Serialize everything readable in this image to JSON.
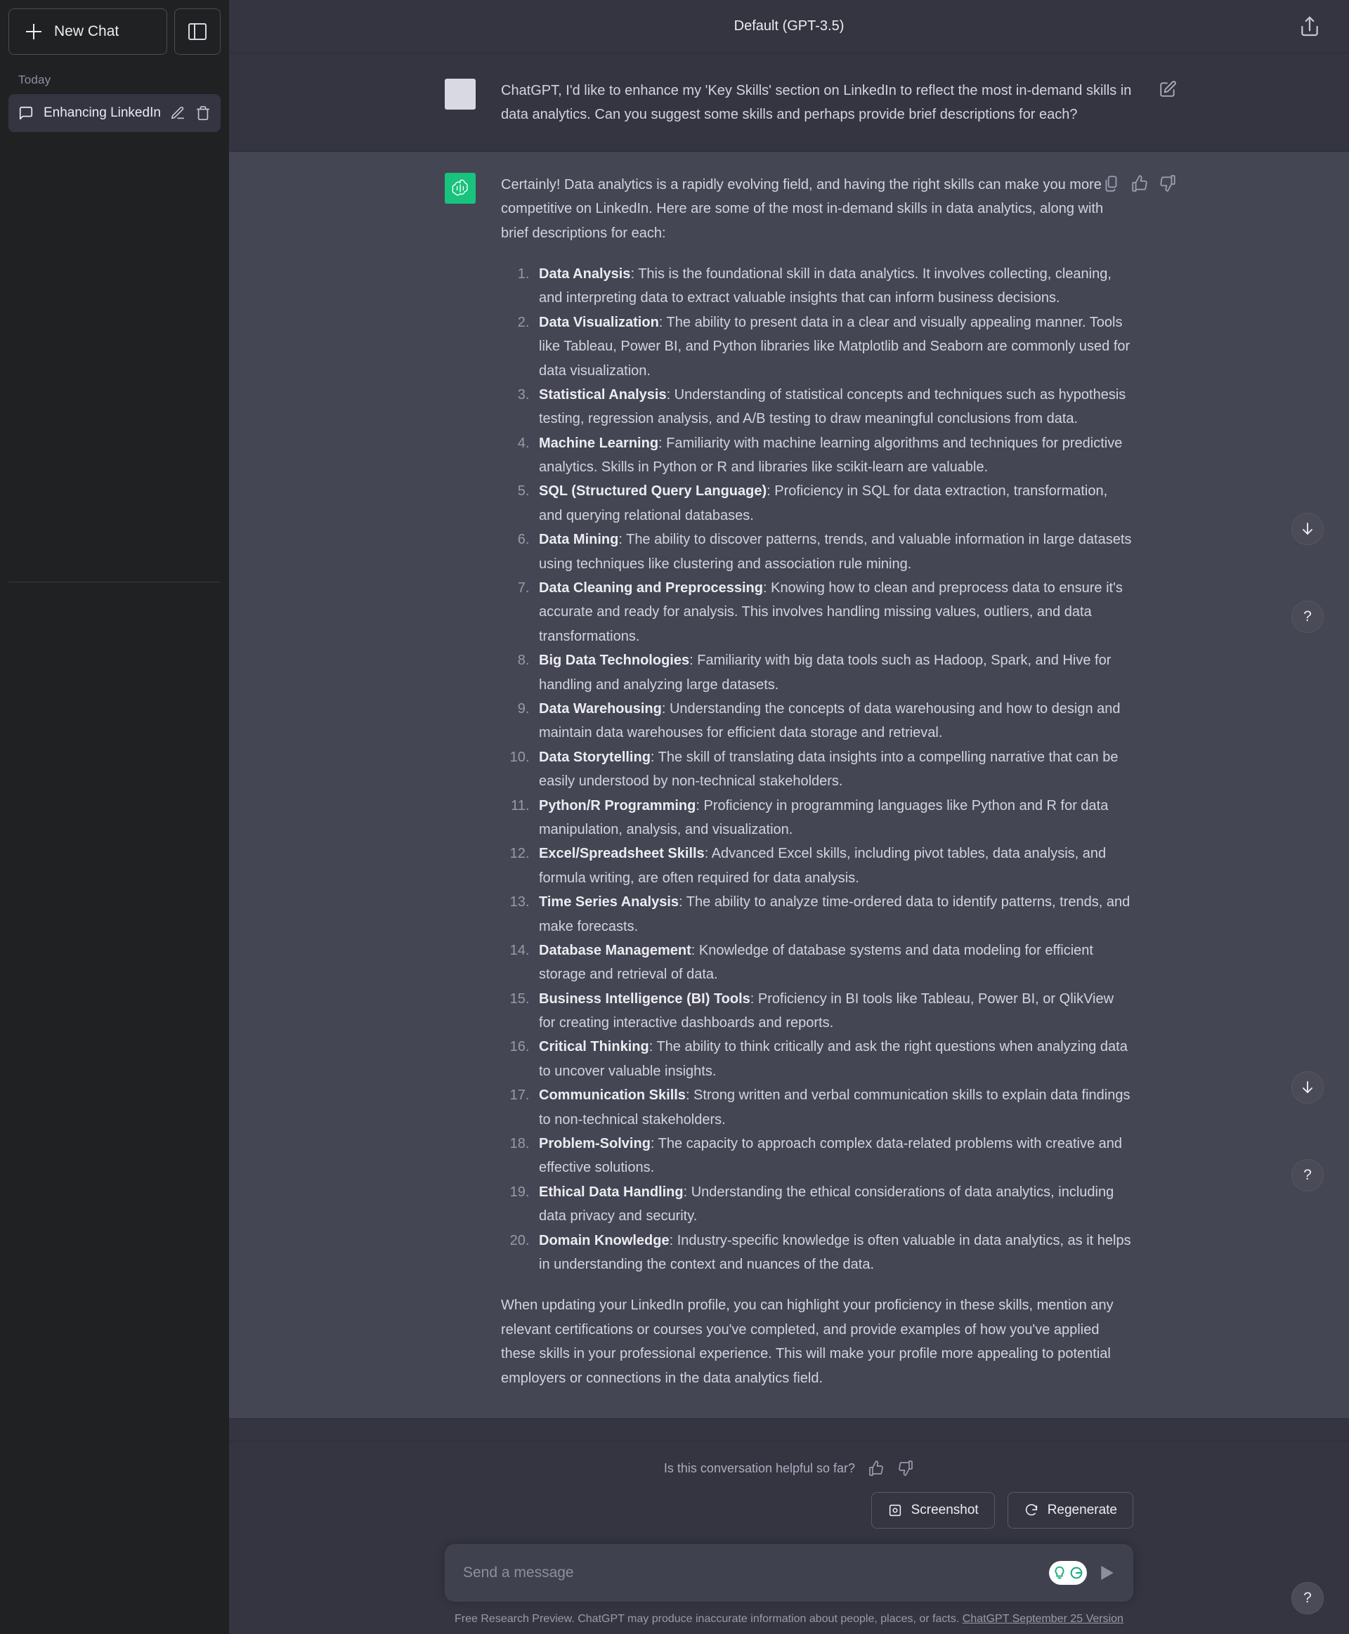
{
  "sidebar": {
    "new_chat_label": "New Chat",
    "group_label": "Today",
    "chats": [
      {
        "title": "Enhancing LinkedIn D"
      }
    ]
  },
  "topbar": {
    "model_label": "Default (GPT-3.5)"
  },
  "conversation": {
    "user_message": "ChatGPT, I'd like to enhance my 'Key Skills' section on LinkedIn to reflect the most in-demand skills in data analytics. Can you suggest some skills and perhaps provide brief descriptions for each?",
    "assistant_intro": "Certainly! Data analytics is a rapidly evolving field, and having the right skills can make you more competitive on LinkedIn. Here are some of the most in-demand skills in data analytics, along with brief descriptions for each:",
    "assistant_closing": "When updating your LinkedIn profile, you can highlight your proficiency in these skills, mention any relevant certifications or courses you've completed, and provide examples of how you've applied these skills in your professional experience. This will make your profile more appealing to potential employers or connections in the data analytics field.",
    "skills": [
      {
        "name": "Data Analysis",
        "desc": ": This is the foundational skill in data analytics. It involves collecting, cleaning, and interpreting data to extract valuable insights that can inform business decisions."
      },
      {
        "name": "Data Visualization",
        "desc": ": The ability to present data in a clear and visually appealing manner. Tools like Tableau, Power BI, and Python libraries like Matplotlib and Seaborn are commonly used for data visualization."
      },
      {
        "name": "Statistical Analysis",
        "desc": ": Understanding of statistical concepts and techniques such as hypothesis testing, regression analysis, and A/B testing to draw meaningful conclusions from data."
      },
      {
        "name": "Machine Learning",
        "desc": ": Familiarity with machine learning algorithms and techniques for predictive analytics. Skills in Python or R and libraries like scikit-learn are valuable."
      },
      {
        "name": "SQL (Structured Query Language)",
        "desc": ": Proficiency in SQL for data extraction, transformation, and querying relational databases."
      },
      {
        "name": "Data Mining",
        "desc": ": The ability to discover patterns, trends, and valuable information in large datasets using techniques like clustering and association rule mining."
      },
      {
        "name": "Data Cleaning and Preprocessing",
        "desc": ": Knowing how to clean and preprocess data to ensure it's accurate and ready for analysis. This involves handling missing values, outliers, and data transformations."
      },
      {
        "name": "Big Data Technologies",
        "desc": ": Familiarity with big data tools such as Hadoop, Spark, and Hive for handling and analyzing large datasets."
      },
      {
        "name": "Data Warehousing",
        "desc": ": Understanding the concepts of data warehousing and how to design and maintain data warehouses for efficient data storage and retrieval."
      },
      {
        "name": "Data Storytelling",
        "desc": ": The skill of translating data insights into a compelling narrative that can be easily understood by non-technical stakeholders."
      },
      {
        "name": "Python/R Programming",
        "desc": ": Proficiency in programming languages like Python and R for data manipulation, analysis, and visualization."
      },
      {
        "name": "Excel/Spreadsheet Skills",
        "desc": ": Advanced Excel skills, including pivot tables, data analysis, and formula writing, are often required for data analysis."
      },
      {
        "name": "Time Series Analysis",
        "desc": ": The ability to analyze time-ordered data to identify patterns, trends, and make forecasts."
      },
      {
        "name": "Database Management",
        "desc": ": Knowledge of database systems and data modeling for efficient storage and retrieval of data."
      },
      {
        "name": "Business Intelligence (BI) Tools",
        "desc": ": Proficiency in BI tools like Tableau, Power BI, or QlikView for creating interactive dashboards and reports."
      },
      {
        "name": "Critical Thinking",
        "desc": ": The ability to think critically and ask the right questions when analyzing data to uncover valuable insights."
      },
      {
        "name": "Communication Skills",
        "desc": ": Strong written and verbal communication skills to explain data findings to non-technical stakeholders."
      },
      {
        "name": "Problem-Solving",
        "desc": ": The capacity to approach complex data-related problems with creative and effective solutions."
      },
      {
        "name": "Ethical Data Handling",
        "desc": ": Understanding the ethical considerations of data analytics, including data privacy and security."
      },
      {
        "name": "Domain Knowledge",
        "desc": ": Industry-specific knowledge is often valuable in data analytics, as it helps in understanding the context and nuances of the data."
      }
    ]
  },
  "footer": {
    "helpful_question": "Is this conversation helpful so far?",
    "screenshot_label": "Screenshot",
    "regenerate_label": "Regenerate",
    "composer_placeholder": "Send a message",
    "disclaimer_text": "Free Research Preview. ChatGPT may produce inaccurate information about people, places, or facts.",
    "version_link": "ChatGPT September 25 Version"
  },
  "float_buttons": {
    "help_label": "?"
  },
  "colors": {
    "accent_green": "#19c37d",
    "sidebar_bg": "#202123",
    "main_bg": "#343541",
    "assistant_bg": "#444654"
  }
}
